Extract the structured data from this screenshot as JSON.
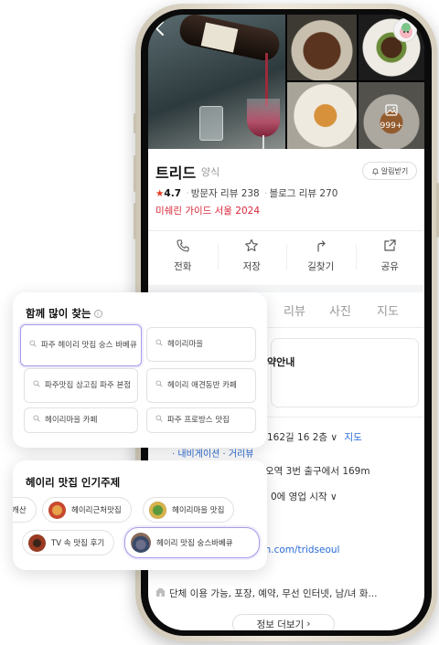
{
  "photos": {
    "more_count": "999+"
  },
  "place": {
    "name": "트리드",
    "category": "양식",
    "alarm_label": "알림받기",
    "rating": "4.7",
    "visitor_reviews": "방문자 리뷰 238",
    "blog_reviews": "블로그 리뷰 270",
    "michelin": "미쉐린 가이드 서울 2024"
  },
  "actions": [
    {
      "label": "전화",
      "icon": "phone-icon"
    },
    {
      "label": "저장",
      "icon": "star-outline-icon"
    },
    {
      "label": "길찾기",
      "icon": "directions-icon"
    },
    {
      "label": "공유",
      "icon": "share-icon"
    }
  ],
  "tabs": [
    "리뷰",
    "사진",
    "지도"
  ],
  "info": {
    "reservation": "약안내",
    "address": "162길 16 2층",
    "map_link": "지도",
    "nav_links": "· 내비게이션 · 거리뷰",
    "station": "오역 3번 출구에서 169m",
    "hours": "0에 영업 시작",
    "website": "m.com/tridseoul",
    "amenities": "단체 이용 가능, 포장, 예약, 무선 인터넷, 남/녀 화...",
    "more_info_label": "정보 더보기"
  },
  "popular_search": {
    "title": "함께 많이 찾는",
    "keywords": [
      "파주 헤이리 맛집 숭스 바베큐",
      "헤이리마을",
      "파주맛집 삼고집 파주 본점",
      "헤이리 애견동반 카페",
      "헤이리마을 카페",
      "파주 프로방스 맛집"
    ]
  },
  "themes": {
    "title": "헤이리 맛집 인기주제",
    "row1": [
      "캐산",
      "헤이리근처맛집",
      "헤이리마을 맛집"
    ],
    "row2": [
      "TV 속 맛집 후기",
      "헤이리 맛집 숭스바베큐"
    ]
  },
  "colors": {
    "accent_red": "#e8381e",
    "michelin_red": "#d9263a",
    "link_blue": "#2a6bd6",
    "highlight_purple": "#a99ae8"
  }
}
